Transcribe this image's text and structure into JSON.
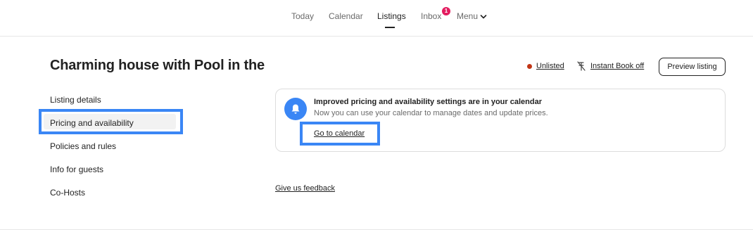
{
  "nav": {
    "today": "Today",
    "calendar": "Calendar",
    "listings": "Listings",
    "inbox": "Inbox",
    "inbox_badge": "1",
    "menu": "Menu",
    "active_tab": "Listings",
    "badge_color": "#e31c5f"
  },
  "header": {
    "title": "Charming house with Pool in the",
    "status_label": "Unlisted",
    "status_color": "#c13515",
    "instant_book_label": "Instant Book off",
    "preview_button": "Preview listing"
  },
  "sidebar": {
    "items": [
      {
        "label": "Listing details"
      },
      {
        "label": "Pricing and availability"
      },
      {
        "label": "Policies and rules"
      },
      {
        "label": "Info for guests"
      },
      {
        "label": "Co-Hosts"
      }
    ],
    "selected": "Pricing and availability"
  },
  "notice": {
    "icon": "bell-icon",
    "title": "Improved pricing and availability settings are in your calendar",
    "subtitle": "Now you can use your calendar to manage dates and update prices.",
    "link": "Go to calendar"
  },
  "feedback_link": "Give us feedback",
  "colors": {
    "highlight": "#3a86f5",
    "text": "#222222",
    "muted": "#6a6a6a"
  }
}
